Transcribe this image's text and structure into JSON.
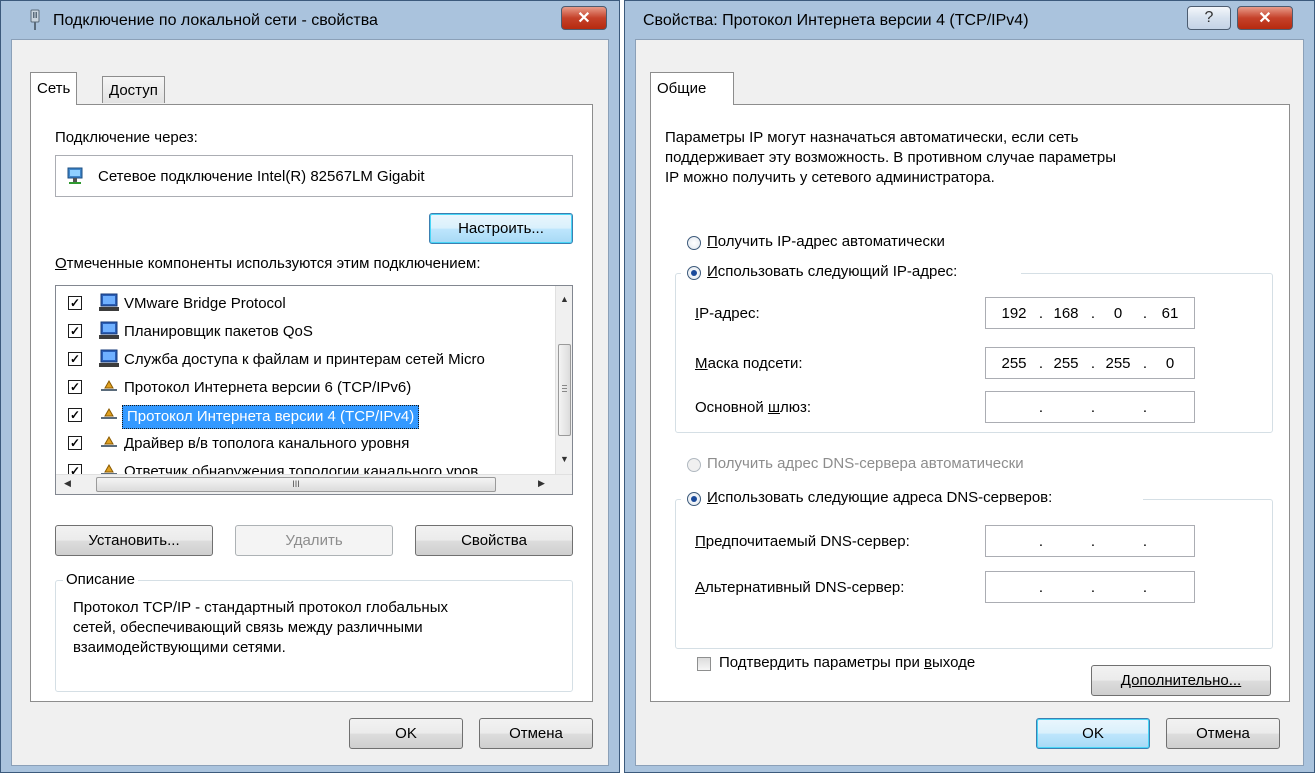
{
  "left": {
    "title": "Подключение по локальной сети - свойства",
    "tabs": [
      "Сеть",
      "Доступ"
    ],
    "connect_via_label": "Подключение через:",
    "adapter_name": "Сетевое подключение Intel(R) 82567LM Gigabit",
    "configure_button": "Настроить...",
    "components_label": "Отмеченные компоненты используются этим подключением:",
    "components": [
      {
        "label": "VMware Bridge Protocol",
        "icon": "network-service-icon",
        "checked": true
      },
      {
        "label": "Планировщик пакетов QoS",
        "icon": "network-service-icon",
        "checked": true
      },
      {
        "label": "Служба доступа к файлам и принтерам сетей Micro",
        "icon": "network-service-icon",
        "checked": true
      },
      {
        "label": "Протокол Интернета версии 6 (TCP/IPv6)",
        "icon": "protocol-icon",
        "checked": true
      },
      {
        "label": "Протокол Интернета версии 4 (TCP/IPv4)",
        "icon": "protocol-icon",
        "checked": true,
        "selected": true
      },
      {
        "label": "Драйвер в/в тополога канального уровня",
        "icon": "protocol-icon",
        "checked": true
      },
      {
        "label": "Ответчик обнаружения топологии канального уров",
        "icon": "protocol-icon",
        "checked": true
      }
    ],
    "hscroll_grip": "III",
    "install_button": "Установить...",
    "remove_button": "Удалить",
    "properties_button": "Свойства",
    "description_label": "Описание",
    "description_text_1": "Протокол TCP/IP - стандартный протокол глобальных",
    "description_text_2": "сетей, обеспечивающий связь между различными",
    "description_text_3": "взаимодействующими сетями.",
    "ok_button": "OK",
    "cancel_button": "Отмена"
  },
  "right": {
    "title": "Свойства: Протокол Интернета версии 4 (TCP/IPv4)",
    "help_button": "?",
    "tab": "Общие",
    "intro_1": "Параметры IP могут назначаться автоматически, если сеть",
    "intro_2": "поддерживает эту возможность. В противном случае параметры",
    "intro_3": "IP можно получить у сетевого администратора.",
    "radio_auto_ip": "Получить IP-адрес автоматически",
    "radio_manual_ip": "Использовать следующий IP-адрес:",
    "ip_label": "IP-адрес:",
    "ip_value": [
      "192",
      "168",
      "0",
      "61"
    ],
    "mask_label": "Маска подсети:",
    "mask_value": [
      "255",
      "255",
      "255",
      "0"
    ],
    "gateway_label": "Основной шлюз:",
    "gateway_value": [
      "",
      "",
      "",
      ""
    ],
    "radio_auto_dns": "Получить адрес DNS-сервера автоматически",
    "radio_manual_dns": "Использовать следующие адреса DNS-серверов:",
    "pref_dns_label": "Предпочитаемый DNS-сервер:",
    "alt_dns_label": "Альтернативный DNS-сервер:",
    "validate_label": "Подтвердить параметры при выходе",
    "advanced_button": "Дополнительно...",
    "ok_button": "OK",
    "cancel_button": "Отмена"
  },
  "colors": {
    "selection": "#3399ff",
    "title_bar": "#aac3dd",
    "close_button": "#c5412a"
  }
}
